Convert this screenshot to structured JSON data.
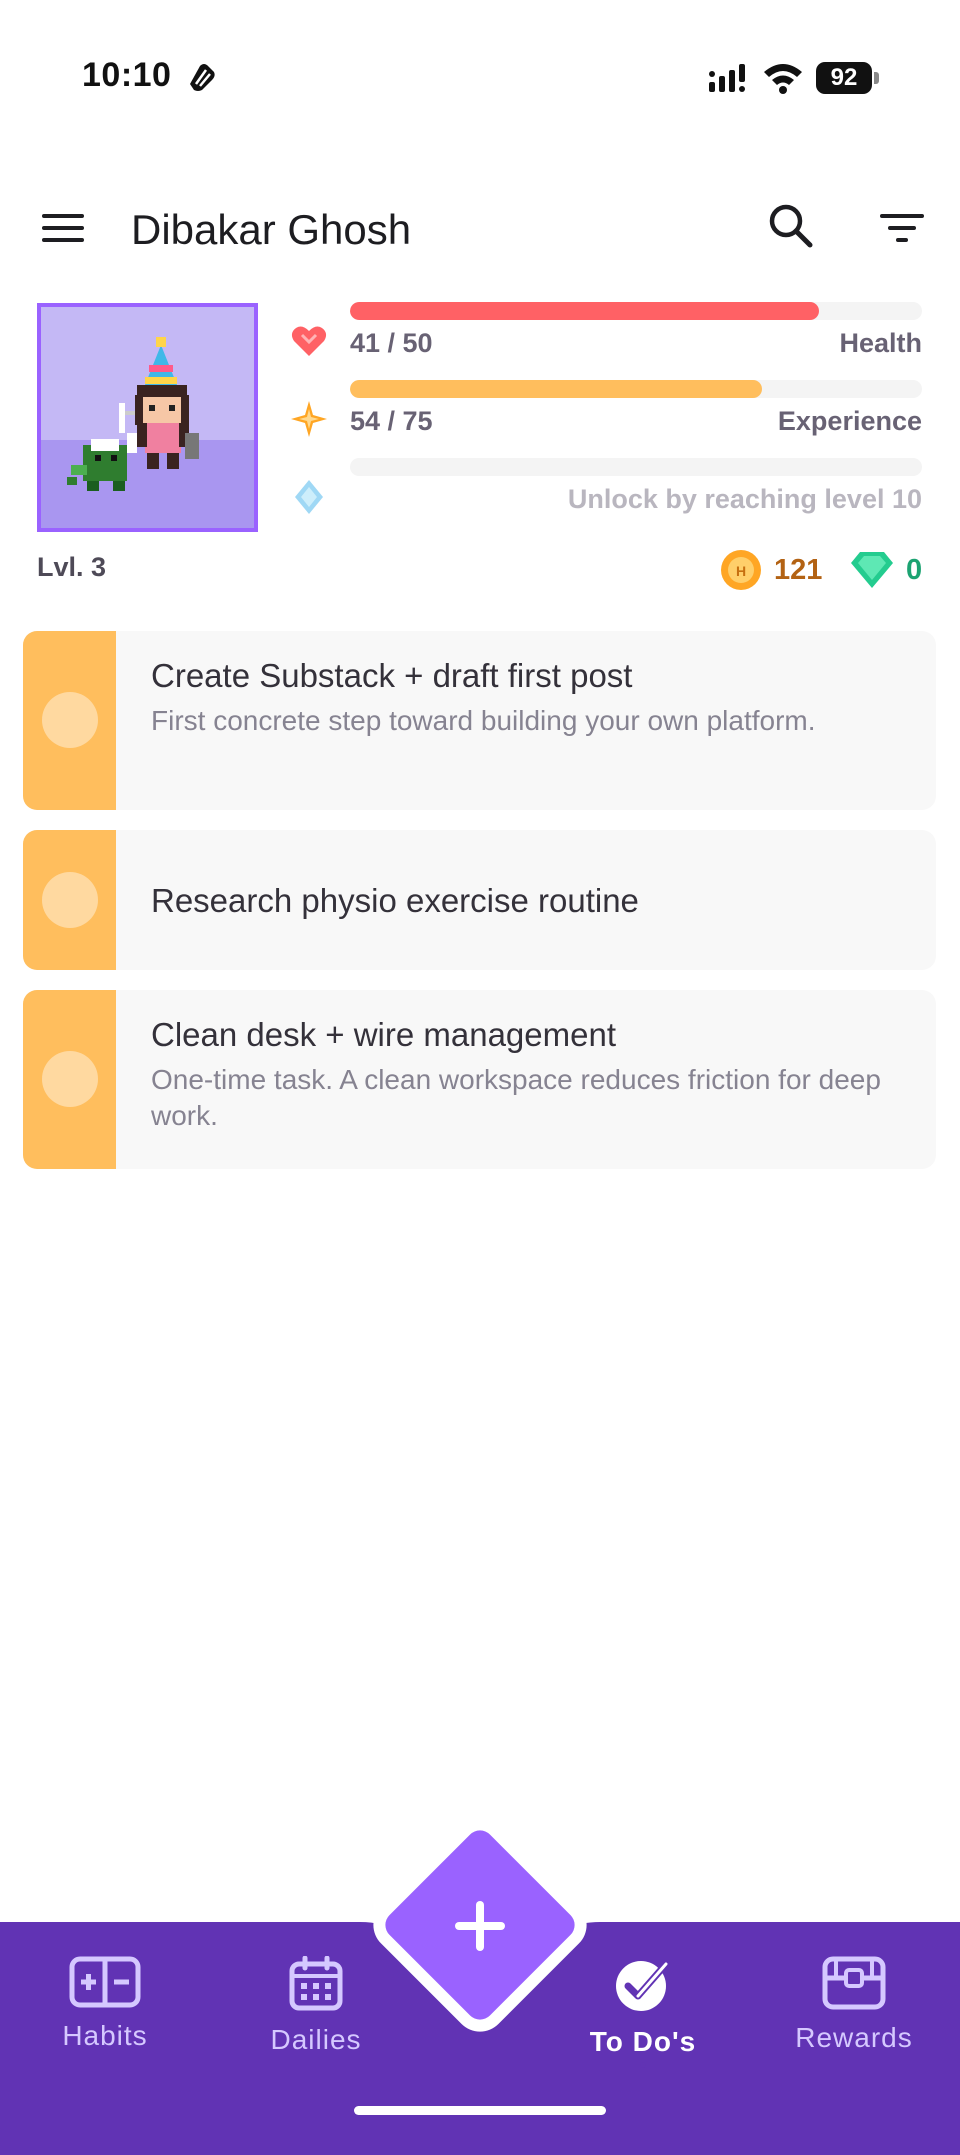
{
  "status_bar": {
    "time": "10:10",
    "battery": "92"
  },
  "app_bar": {
    "title": "Dibakar Ghosh",
    "menu_icon": "hamburger-menu-icon",
    "search_icon": "search-icon",
    "filter_icon": "filter-icon"
  },
  "header": {
    "level": "Lvl. 3",
    "health": {
      "value": "41 / 50",
      "label": "Health",
      "fraction": 0.82,
      "color": "#ff6165"
    },
    "experience": {
      "value": "54 / 75",
      "label": "Experience",
      "fraction": 0.72,
      "color": "#ffbe5d"
    },
    "mana": {
      "locked_text": "Unlock by reaching level 10",
      "fraction": 0
    },
    "gold": "121",
    "gems": "0",
    "gold_color": "#b36213",
    "gem_color": "#1ca372"
  },
  "tasks": [
    {
      "title": "Create Substack + draft first post",
      "notes": "First concrete step toward building your own platform."
    },
    {
      "title": "Research physio exercise routine",
      "notes": ""
    },
    {
      "title": "Clean desk + wire management",
      "notes": "One-time task. A clean workspace reduces friction for deep work."
    }
  ],
  "task_color": "#ffbe5d",
  "bottom_nav": {
    "items": [
      {
        "label": "Habits",
        "icon": "habits-icon"
      },
      {
        "label": "Dailies",
        "icon": "calendar-icon"
      },
      {
        "label": "To Do's",
        "icon": "checkmark-circle-icon",
        "active": true
      },
      {
        "label": "Rewards",
        "icon": "treasure-chest-icon"
      }
    ],
    "add_button_icon": "plus-icon",
    "color": "#6133b4",
    "accent": "#9a62ff"
  }
}
